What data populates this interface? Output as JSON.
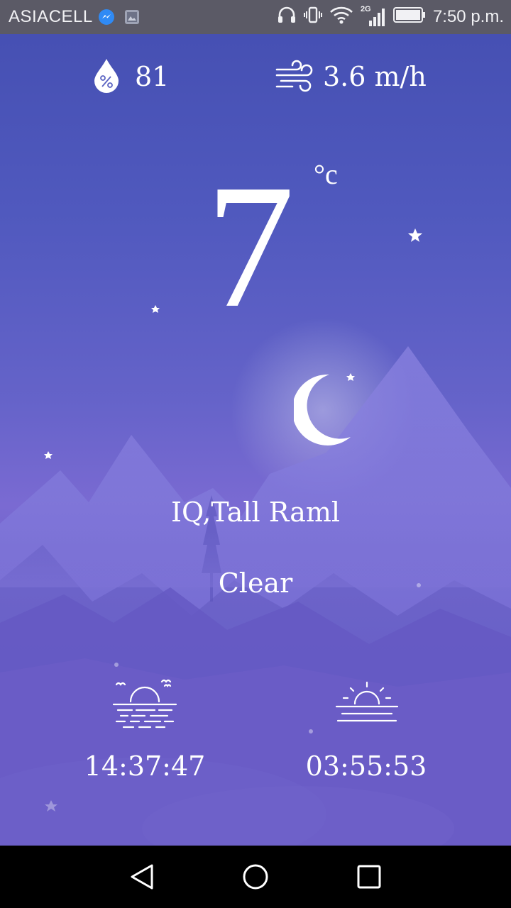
{
  "status_bar": {
    "carrier": "ASIACELL",
    "network_label": "2G",
    "time": "7:50 p.m."
  },
  "weather": {
    "humidity": "81",
    "wind": "3.6 m/h",
    "temperature": "7",
    "unit": "°c",
    "location": "IQ,Tall Raml",
    "condition": "Clear",
    "sunset_time": "14:37:47",
    "sunrise_time": "03:55:53"
  },
  "icons": {
    "humidity": "humidity-drop-icon",
    "wind": "wind-icon",
    "moon": "moon-icon",
    "sunset": "sunset-icon",
    "sunrise": "sunrise-icon"
  },
  "colors": {
    "status_bar": "#5b5a66",
    "sky_top": "#4650b3",
    "sky_bottom": "#6a5cc4",
    "text": "#ffffff"
  }
}
